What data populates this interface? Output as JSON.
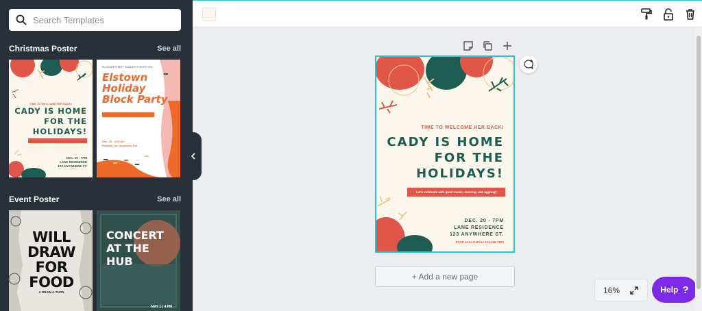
{
  "search": {
    "placeholder": "Search Templates"
  },
  "sections": [
    {
      "title": "Christmas Poster",
      "see_all": "See all",
      "templates": [
        {
          "line1": "TIME TO WELCOME HER BACK!",
          "big": [
            "CADY IS HOME",
            "FOR THE",
            "HOLIDAYS!"
          ],
          "small": [
            "DEC. 20 - 7PM",
            "LANE RESIDENCE",
            "123 ANYWHERE ST."
          ]
        },
        {
          "header": "ELSTOWN STREET RESIDENTS INVITE YOU",
          "title": [
            "Elstown",
            "Holiday",
            "Block Party"
          ],
          "date": "Dec. 15 - 3:00 pm",
          "place": "Elstown cor. Anywhere Sts."
        }
      ]
    },
    {
      "title": "Event Poster",
      "see_all": "See all",
      "templates": [
        {
          "title": [
            "WILL",
            "DRAW",
            "FOR",
            "FOOD"
          ],
          "sub": "A DRAW-A-THON"
        },
        {
          "title": [
            "CONCERT",
            "AT THE",
            "HUB"
          ],
          "footer": "MAY 1 | 4 PM"
        }
      ]
    }
  ],
  "design": {
    "line1": "TIME TO WELCOME HER BACK!",
    "big": [
      "CADY IS HOME",
      "FOR THE",
      "HOLIDAYS!"
    ],
    "bar_text": "Let's celebrate with great music, dancing, and eggnog!",
    "small": [
      "DEC. 20 - 7PM",
      "LANE RESIDENCE",
      "123 ANYWHERE ST."
    ],
    "rsvp": "RSVP Anna Katrina 123-456-7890"
  },
  "canvas": {
    "add_page_label": "+ Add a new page",
    "zoom": "16%",
    "help_label": "Help",
    "help_icon": "?"
  },
  "colors": {
    "sidebar": "#293039",
    "accent": "#25c4d3",
    "help": "#7d2ae8",
    "coral": "#e0574a",
    "teal": "#1f5c51"
  },
  "icons": {
    "search": "search-icon",
    "collapse": "chevron-left-icon",
    "paint": "paint-roller-icon",
    "lock": "unlock-icon",
    "delete": "trash-icon",
    "note": "note-icon",
    "duplicate": "copy-icon",
    "add": "plus-icon",
    "comment": "add-comment-icon",
    "fullscreen": "expand-icon"
  }
}
